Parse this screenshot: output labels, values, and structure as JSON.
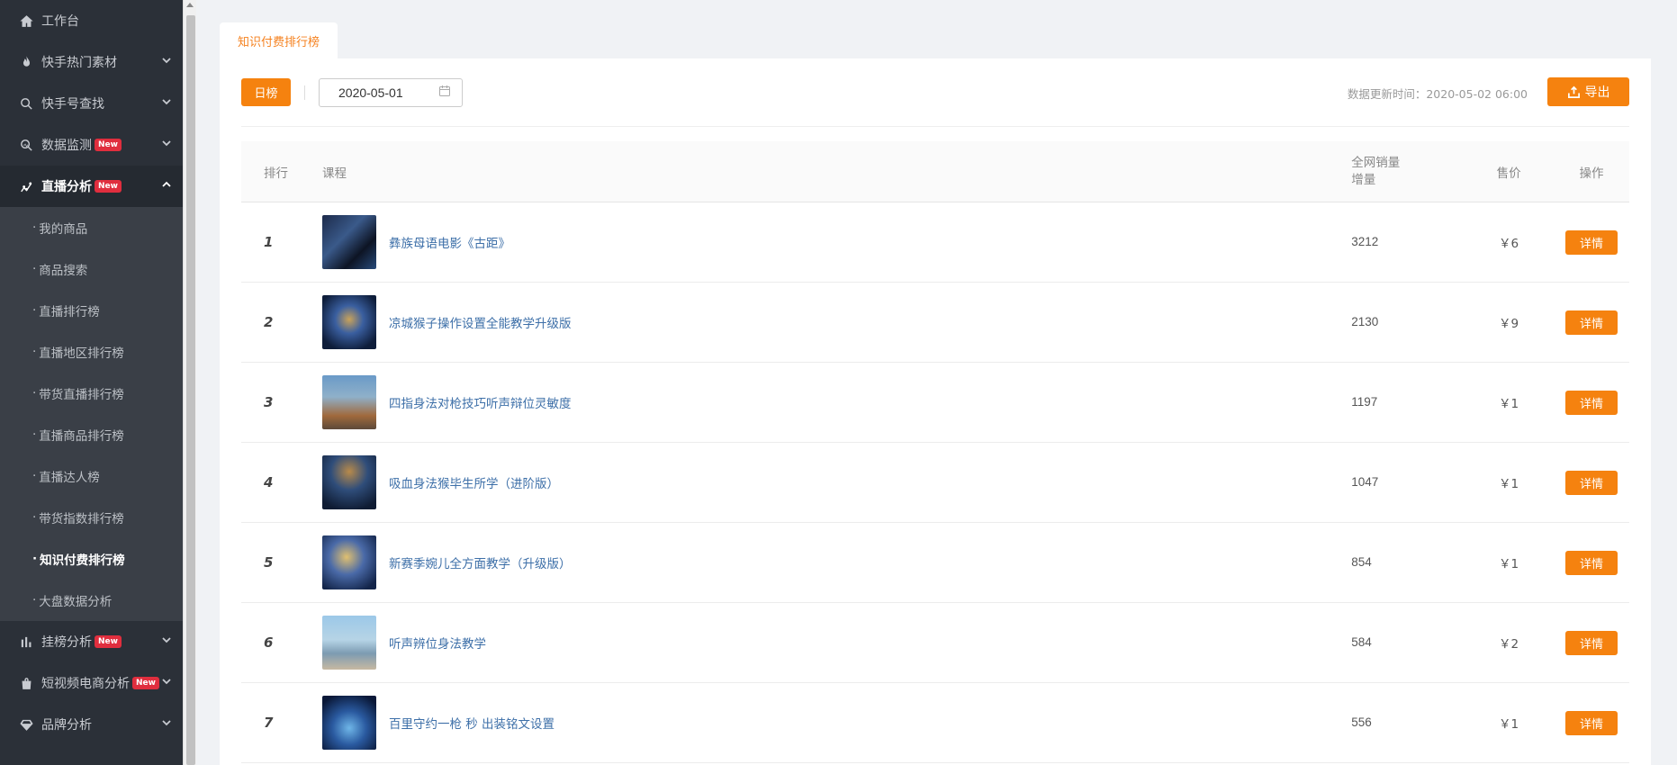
{
  "sidebar": {
    "items": [
      {
        "label": "工作台",
        "icon": "home-icon"
      },
      {
        "label": "快手热门素材",
        "icon": "fire-icon"
      },
      {
        "label": "快手号查找",
        "icon": "search-icon"
      },
      {
        "label": "数据监测",
        "icon": "monitor-icon",
        "badge": "New"
      },
      {
        "label": "直播分析",
        "icon": "chart-line-icon",
        "badge": "New"
      }
    ],
    "sub_items": [
      "我的商品",
      "商品搜索",
      "直播排行榜",
      "直播地区排行榜",
      "带货直播排行榜",
      "直播商品排行榜",
      "直播达人榜",
      "带货指数排行榜",
      "知识付费排行榜",
      "大盘数据分析"
    ],
    "items_after": [
      {
        "label": "挂榜分析",
        "icon": "bar-chart-icon",
        "badge": "New"
      },
      {
        "label": "短视频电商分析",
        "icon": "shopping-bag-icon",
        "badge": "New"
      },
      {
        "label": "品牌分析",
        "icon": "diamond-icon"
      }
    ]
  },
  "tab": {
    "label": "知识付费排行榜"
  },
  "toolbar": {
    "day_label": "日榜",
    "date_value": "2020-05-01",
    "update_time": "数据更新时间：2020-05-02 06:00",
    "export_label": "导出"
  },
  "table": {
    "headers": {
      "rank": "排行",
      "course": "课程",
      "sales_line1": "全网销量",
      "sales_line2": "增量",
      "price": "售价",
      "op": "操作"
    },
    "rows": [
      {
        "rank": "1",
        "title": "彝族母语电影《古距》",
        "sales": "3212",
        "price": "￥6",
        "action": "详情"
      },
      {
        "rank": "2",
        "title": "凉城猴子操作设置全能教学升级版",
        "sales": "2130",
        "price": "￥9",
        "action": "详情"
      },
      {
        "rank": "3",
        "title": "四指身法对枪技巧听声辩位灵敏度",
        "sales": "1197",
        "price": "￥1",
        "action": "详情"
      },
      {
        "rank": "4",
        "title": "吸血身法猴毕生所学（进阶版）",
        "sales": "1047",
        "price": "￥1",
        "action": "详情"
      },
      {
        "rank": "5",
        "title": "新赛季婉儿全方面教学（升级版）",
        "sales": "854",
        "price": "￥1",
        "action": "详情"
      },
      {
        "rank": "6",
        "title": "听声辨位身法教学",
        "sales": "584",
        "price": "￥2",
        "action": "详情"
      },
      {
        "rank": "7",
        "title": "百里守约一枪 秒 出装铭文设置",
        "sales": "556",
        "price": "￥1",
        "action": "详情"
      }
    ]
  },
  "colors": {
    "accent": "#f5820f",
    "sidebar_bg": "#2b3038",
    "link": "#3d6fa8"
  }
}
